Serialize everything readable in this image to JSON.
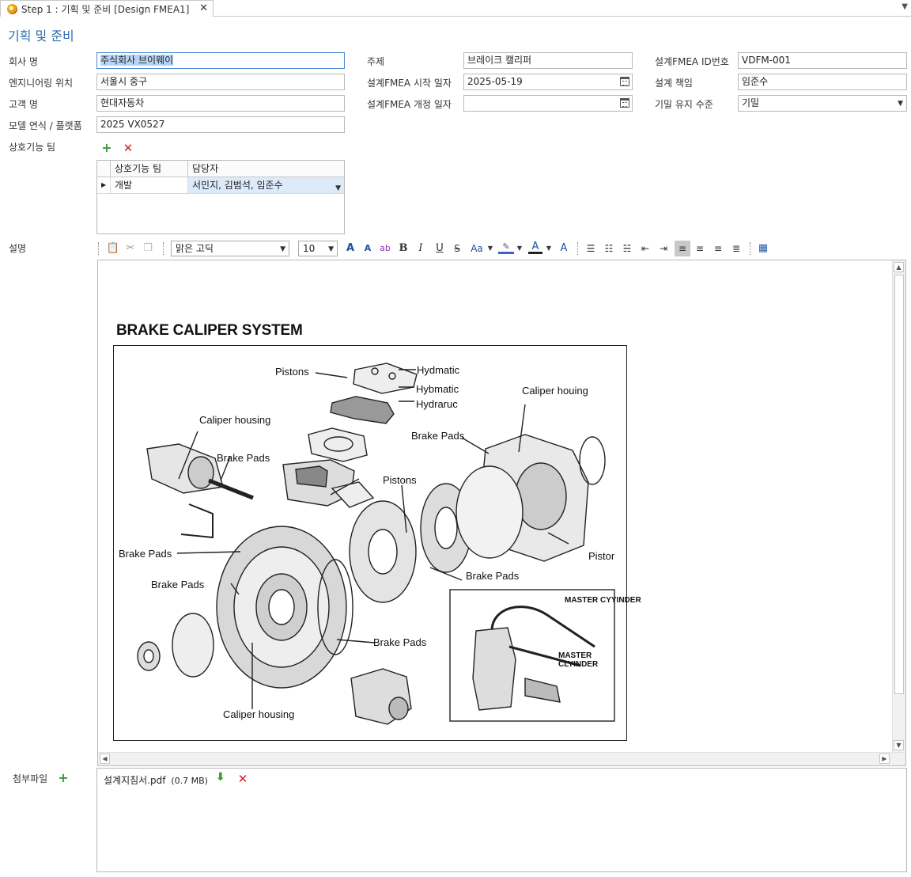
{
  "tab": {
    "title": "Step 1 : 기획 및 준비 [Design FMEA1]",
    "close": "✕",
    "overflow": "▼"
  },
  "heading": "기획 및 준비",
  "fields": {
    "company_label": "회사 명",
    "company_value": "주식회사 브이웨이",
    "location_label": "엔지니어링 위치",
    "location_value": "서울시 중구",
    "customer_label": "고객 명",
    "customer_value": "현대자동차",
    "model_label": "모델 연식 / 플랫폼",
    "model_value": "2025 VX0527",
    "subject_label": "주제",
    "subject_value": "브레이크 캘리퍼",
    "start_label": "설계FMEA 시작 일자",
    "start_value": "2025-05-19",
    "revision_label": "설계FMEA 개정 일자",
    "revision_value": "",
    "id_label": "설계FMEA ID번호",
    "id_value": "VDFM-001",
    "owner_label": "설계 책임",
    "owner_value": "임준수",
    "confidential_label": "기밀 유지 수준",
    "confidential_value": "기밀"
  },
  "team": {
    "label": "상호기능 팀",
    "add_icon": "+",
    "delete_icon": "✕",
    "columns": [
      "상호기능 팀",
      "담당자"
    ],
    "rows": [
      {
        "team": "개발",
        "members": "서민지, 김범석, 임준수"
      }
    ]
  },
  "description": {
    "label": "설명",
    "font_name": "맑은 고딕",
    "font_size": "10",
    "toolbar": {
      "case": "Aa"
    }
  },
  "diagram": {
    "title": "BRAKE CALIPER SYSTEM",
    "labels": [
      "Pistons",
      "Hydmatic",
      "Hybmatic",
      "Hydraruc",
      "Caliper houing",
      "Caliper housing",
      "Brake Pads",
      "Brake Pads",
      "Pistons",
      "Brake Pads",
      "Pistor",
      "Brake Pads",
      "Brake Pads",
      "Brake Pads",
      "Caliper housing",
      "MASTER CYYINDER",
      "MASTER CLYINDER"
    ]
  },
  "attachments": {
    "label": "첨부파일",
    "add_icon": "+",
    "files": [
      {
        "name": "설계지침서.pdf",
        "size": "(0.7 MB)"
      }
    ]
  }
}
